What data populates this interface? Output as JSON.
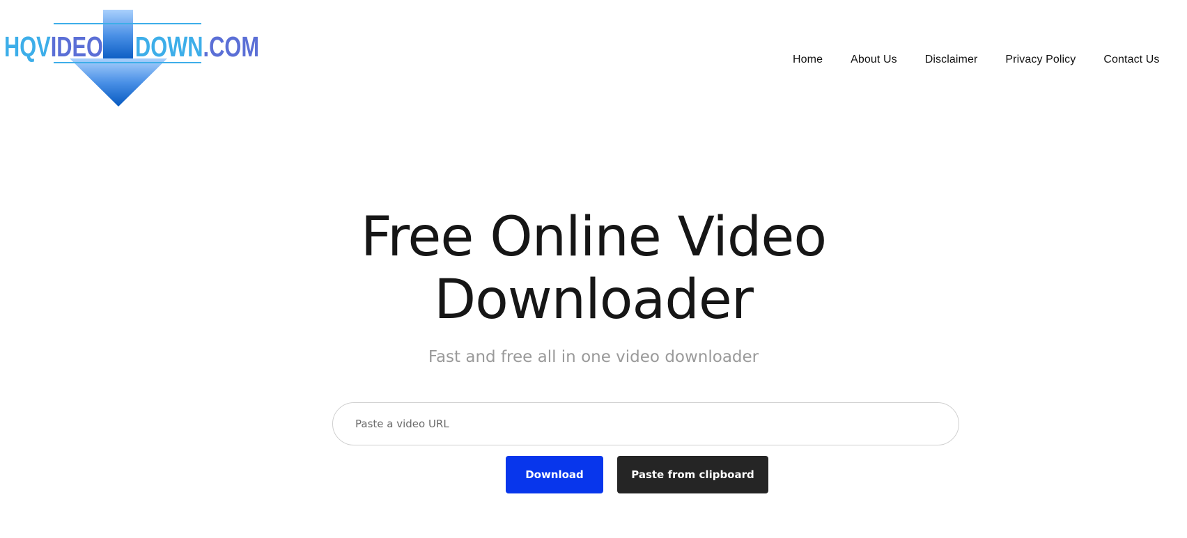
{
  "site": {
    "logo": {
      "text_left": "HQVIDEO",
      "text_right": "DOWN.COM",
      "icon": "download-arrow-icon",
      "colors": {
        "light_blue": "#3daee9",
        "indigo": "#5b6fd6",
        "arrow_top": "#9cc8fb",
        "arrow_bottom": "#0b5fc2"
      }
    }
  },
  "nav": {
    "items": [
      {
        "label": "Home"
      },
      {
        "label": "About Us"
      },
      {
        "label": "Disclaimer"
      },
      {
        "label": "Privacy Policy"
      },
      {
        "label": "Contact Us"
      }
    ]
  },
  "hero": {
    "title_line1": "Free Online Video",
    "title_line2": "Downloader",
    "subtitle": "Fast and free all in one video downloader"
  },
  "form": {
    "url_input": {
      "value": "",
      "placeholder": "Paste a video URL"
    },
    "download_label": "Download",
    "paste_label": "Paste from clipboard",
    "colors": {
      "download_bg": "#0836ec",
      "paste_bg": "#252525"
    }
  }
}
